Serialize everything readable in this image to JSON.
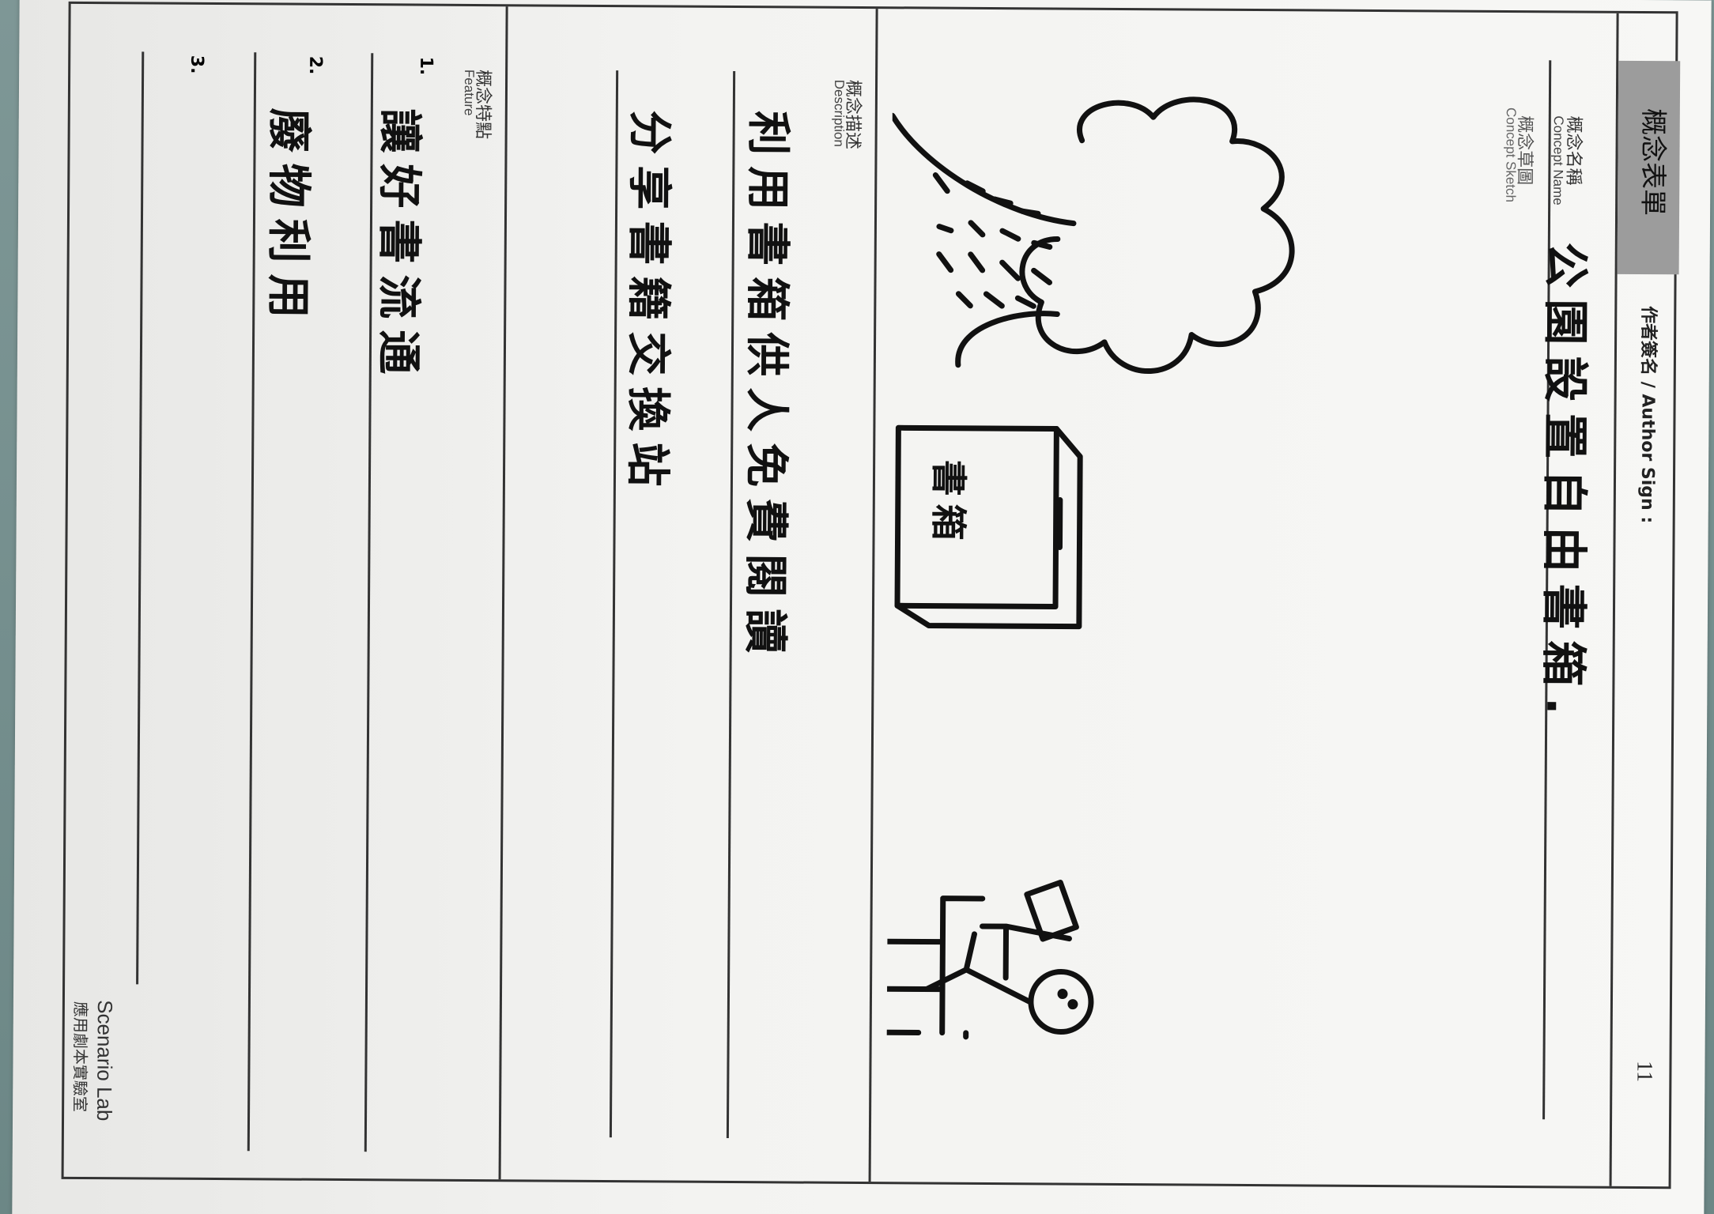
{
  "form": {
    "title": "概念表單",
    "author_sign": "作者簽名 / Author Sign :",
    "page_number": "11",
    "concept_name_zh": "概念名稱",
    "concept_name_en": "Concept Name",
    "concept_name_value": "公園設置自由書箱.",
    "sketch_zh": "概念草圖",
    "sketch_en": "Concept Sketch",
    "sketch_book_label": "書箱",
    "description_zh": "概念描述",
    "description_en": "Description",
    "description_lines": [
      "利用書箱供人免費閱讀",
      "分享書籍交換站"
    ],
    "feature_zh": "概念特點",
    "feature_en": "Feature",
    "features": [
      {
        "num": "1.",
        "text": "讓好書流通"
      },
      {
        "num": "2.",
        "text": "廢物利用"
      },
      {
        "num": "3.",
        "text": ""
      }
    ],
    "brand_line1": "Scenario Lab",
    "brand_line2": "應用劇本實驗室"
  }
}
